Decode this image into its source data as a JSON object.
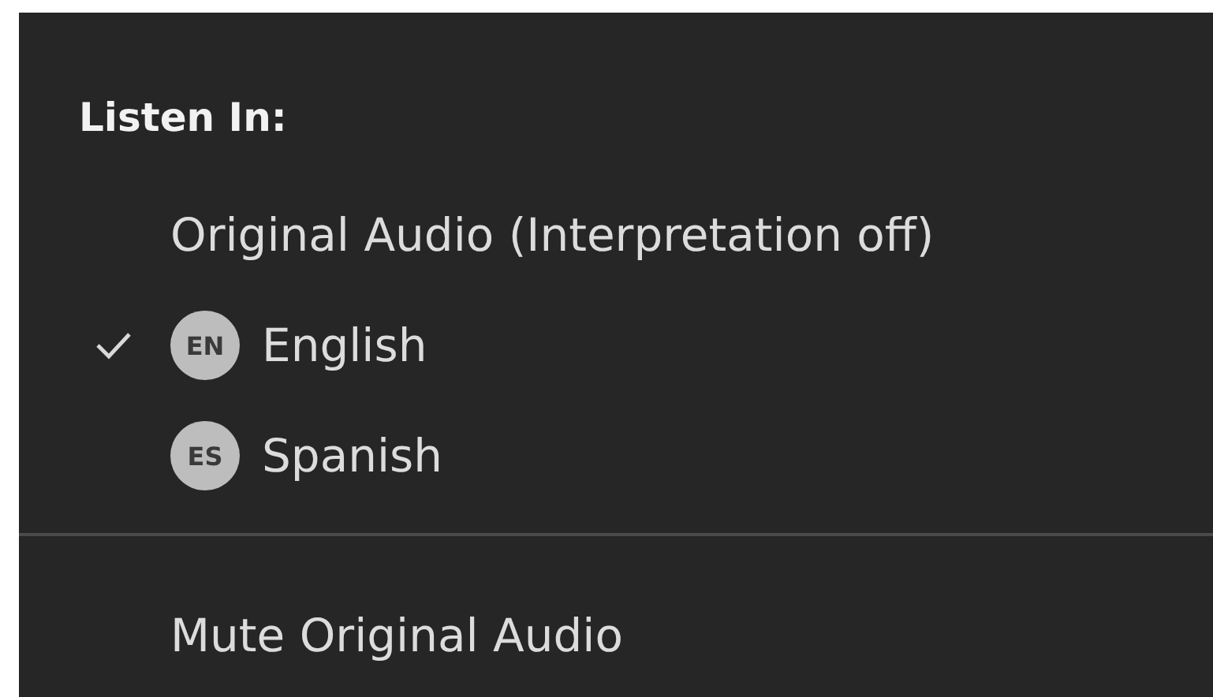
{
  "menu": {
    "heading": "Listen In:",
    "options": [
      {
        "kind": "plain",
        "label": "Original Audio (Interpretation off)",
        "selected": false
      },
      {
        "kind": "language",
        "badge": "EN",
        "label": "English",
        "selected": true
      },
      {
        "kind": "language",
        "badge": "ES",
        "label": "Spanish",
        "selected": false
      }
    ],
    "actions": [
      {
        "label": "Mute Original Audio"
      }
    ]
  }
}
